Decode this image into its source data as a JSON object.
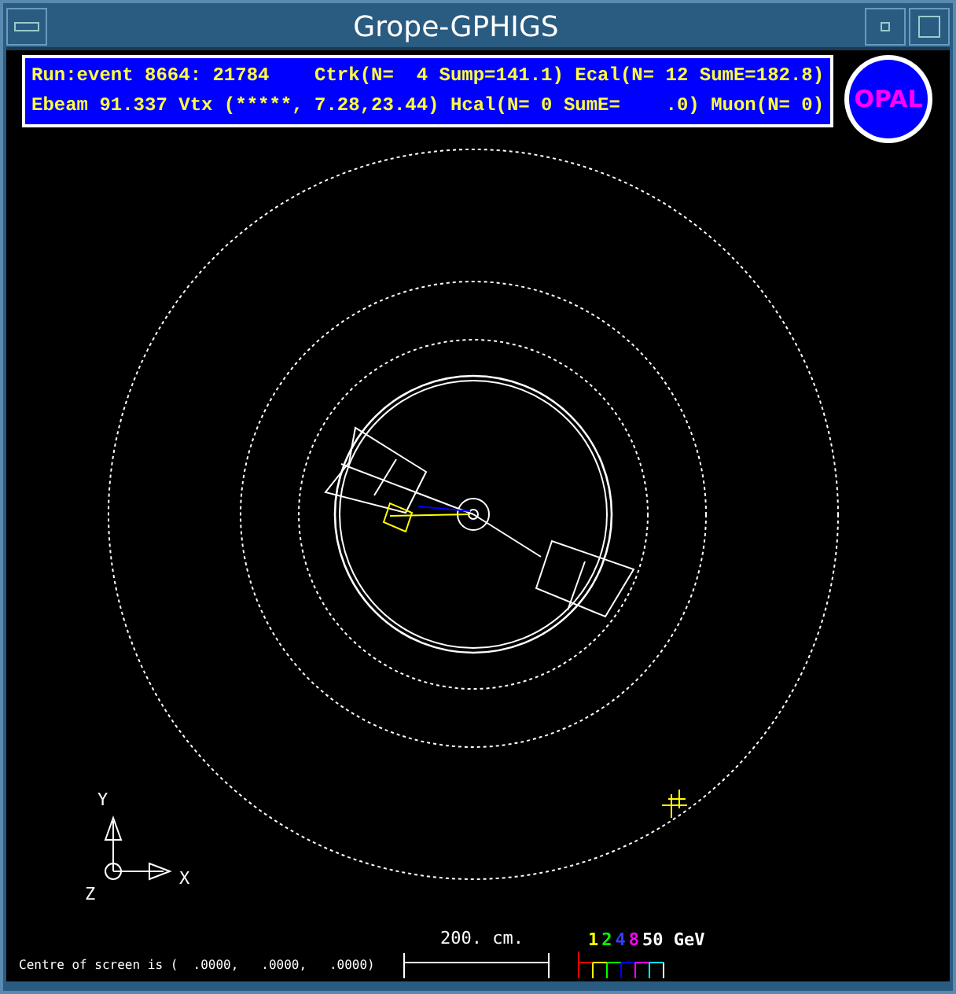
{
  "window": {
    "title": "Grope-GPHIGS"
  },
  "header": {
    "lines": [
      "Run:event 8664: 21784    Ctrk(N=  4 Sump=141.1) Ecal(N= 12 SumE=182.8)",
      "Ebeam 91.337 Vtx (*****, 7.28,23.44) Hcal(N= 0 SumE=    .0) Muon(N= 0)"
    ]
  },
  "logo": {
    "text": "OPAL"
  },
  "axes": {
    "y": "Y",
    "x": "X",
    "z": "Z"
  },
  "footer": {
    "centre": "Centre of screen is (  .0000,   .0000,   .0000)",
    "scale": "200. cm.",
    "energy_scale": [
      {
        "label": "1",
        "color": "#ffff00"
      },
      {
        "label": "2",
        "color": "#00ff00"
      },
      {
        "label": "4",
        "color": "#3a3aff"
      },
      {
        "label": "8",
        "color": "#ff00ff"
      },
      {
        "label": "50 GeV",
        "color": "#ffffff"
      }
    ]
  }
}
